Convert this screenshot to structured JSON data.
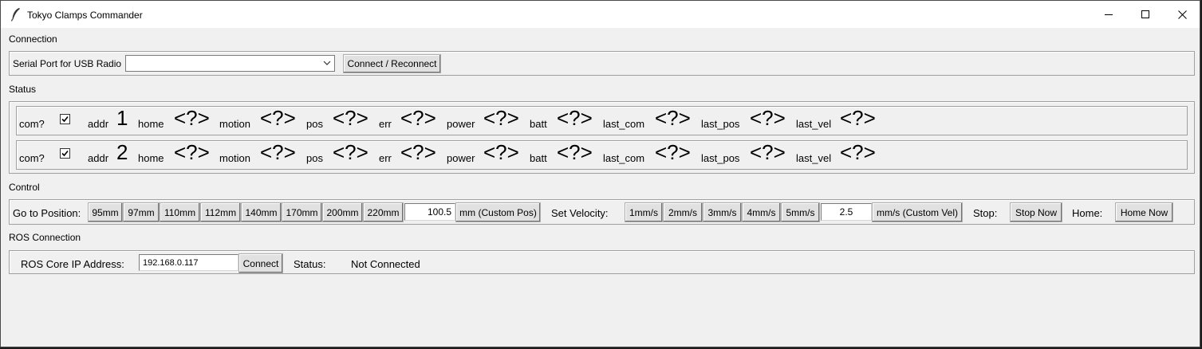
{
  "window": {
    "title": "Tokyo Clamps Commander"
  },
  "connection": {
    "section_label": "Connection",
    "serial_label": "Serial Port for USB Radio",
    "serial_value": "",
    "connect_button": "Connect / Reconnect"
  },
  "status": {
    "section_label": "Status",
    "rows": [
      {
        "com_label": "com?",
        "checked": true,
        "addr_label": "addr",
        "addr_value": "1",
        "home_label": "home",
        "home_value": "<?>",
        "motion_label": "motion",
        "motion_value": "<?>",
        "pos_label": "pos",
        "pos_value": "<?>",
        "err_label": "err",
        "err_value": "<?>",
        "power_label": "power",
        "power_value": "<?>",
        "batt_label": "batt",
        "batt_value": "<?>",
        "last_com_label": "last_com",
        "last_com_value": "<?>",
        "last_pos_label": "last_pos",
        "last_pos_value": "<?>",
        "last_vel_label": "last_vel",
        "last_vel_value": "<?>"
      },
      {
        "com_label": "com?",
        "checked": true,
        "addr_label": "addr",
        "addr_value": "2",
        "home_label": "home",
        "home_value": "<?>",
        "motion_label": "motion",
        "motion_value": "<?>",
        "pos_label": "pos",
        "pos_value": "<?>",
        "err_label": "err",
        "err_value": "<?>",
        "power_label": "power",
        "power_value": "<?>",
        "batt_label": "batt",
        "batt_value": "<?>",
        "last_com_label": "last_com",
        "last_com_value": "<?>",
        "last_pos_label": "last_pos",
        "last_pos_value": "<?>",
        "last_vel_label": "last_vel",
        "last_vel_value": "<?>"
      }
    ]
  },
  "control": {
    "section_label": "Control",
    "goto_label": "Go to Position:",
    "positions": [
      "95mm",
      "97mm",
      "110mm",
      "112mm",
      "140mm",
      "170mm",
      "200mm",
      "220mm"
    ],
    "custom_pos_value": "100.5",
    "custom_pos_button": "mm (Custom Pos)",
    "velocity_label": "Set Velocity:",
    "velocities": [
      "1mm/s",
      "2mm/s",
      "3mm/s",
      "4mm/s",
      "5mm/s"
    ],
    "custom_vel_value": "2.5",
    "custom_vel_button": "mm/s (Custom Vel)",
    "stop_label": "Stop:",
    "stop_button": "Stop Now",
    "home_label": "Home:",
    "home_button": "Home Now"
  },
  "ros": {
    "section_label": "ROS Connection",
    "ip_label": "ROS Core IP Address:",
    "ip_value": "192.168.0.117",
    "connect_button": "Connect",
    "status_label": "Status:",
    "status_value": "Not Connected"
  }
}
